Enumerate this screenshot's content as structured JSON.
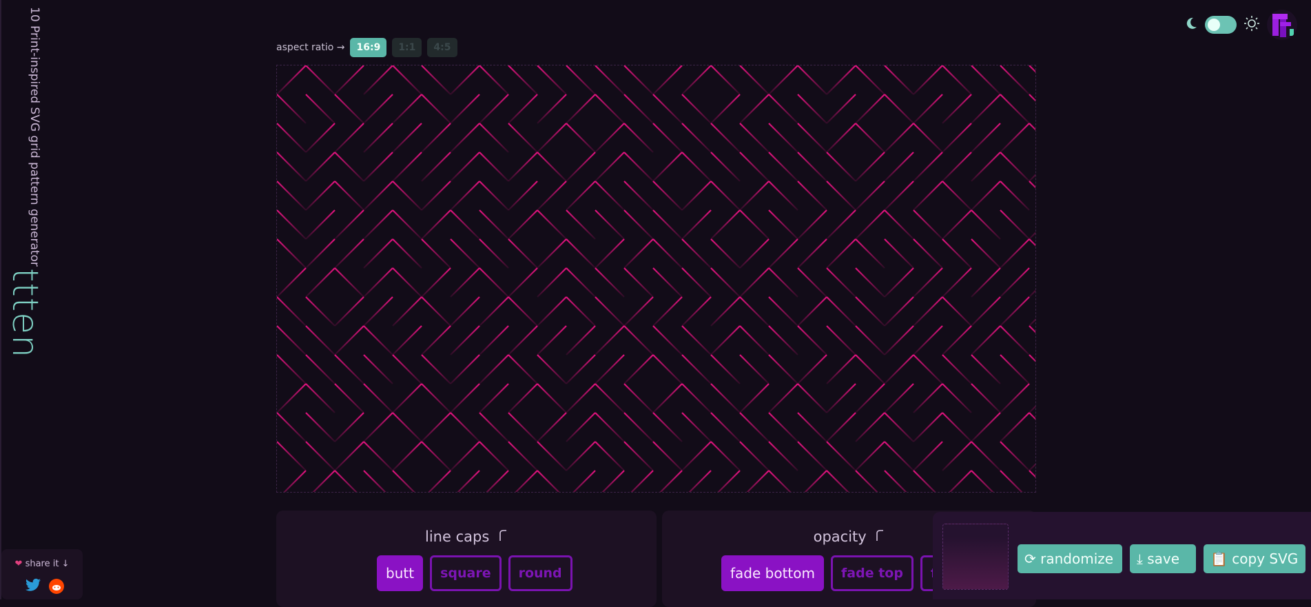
{
  "app": {
    "brand": "ttten",
    "tagline": "10 Print-inspired SVG grid pattern generator"
  },
  "aspect_ratio": {
    "label": "aspect ratio →",
    "options": [
      "16:9",
      "1:1",
      "4:5"
    ],
    "selected": "16:9"
  },
  "theme": {
    "moon_icon": "moon-icon",
    "sun_icon": "sun-icon",
    "toggle_icon": "theme-toggle"
  },
  "panels": {
    "line_caps": {
      "title": "line caps",
      "options": [
        "butt",
        "square",
        "round"
      ],
      "selected": "butt"
    },
    "opacity": {
      "title": "opacity",
      "options": [
        "fade bottom",
        "fade top",
        "fad"
      ],
      "selected": "fade bottom"
    }
  },
  "actions": {
    "randomize": "randomize",
    "save": "save",
    "copy_svg": "copy SVG"
  },
  "share": {
    "label": "share it ↓",
    "icons": [
      "twitter-icon",
      "reddit-icon"
    ]
  },
  "colors": {
    "background": "#120c18",
    "accent": "#5ab7a8",
    "pattern_stroke": "#e3137f",
    "purple": "#8a12c4"
  }
}
